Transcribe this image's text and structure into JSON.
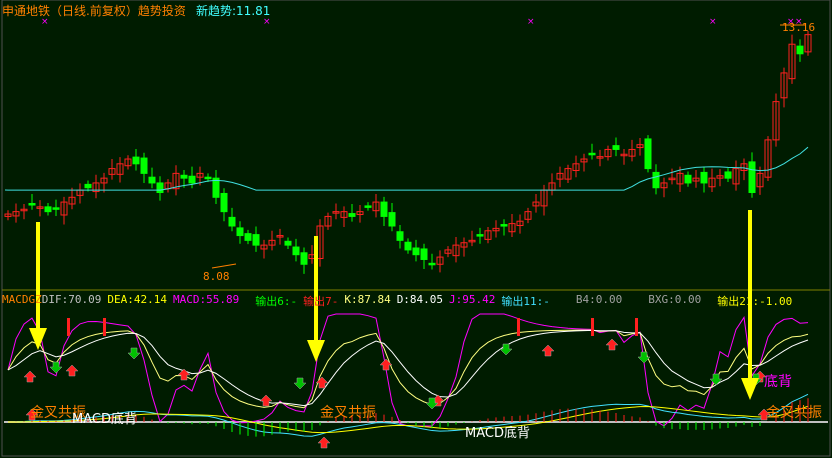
{
  "header": {
    "title": "申通地铁（日线.前复权）趋势投资",
    "trend_label": "新趋势:11.81"
  },
  "price_labels": {
    "high": "13.16",
    "low": "8.08"
  },
  "indicator_bar": [
    {
      "text": "MACDGZ",
      "color": "#ff8000"
    },
    {
      "text": "DIF:70.09",
      "color": "#c0c0c0"
    },
    {
      "text": "DEA:42.14",
      "color": "#ffff00"
    },
    {
      "text": "MACD:55.89",
      "color": "#ff00ff"
    },
    {
      "text": "输出6:-",
      "color": "#00ff00"
    },
    {
      "text": "输出7-",
      "color": "#ff2020"
    },
    {
      "text": "K:87.84",
      "color": "#ffff80"
    },
    {
      "text": "D:84.05",
      "color": "#ffffff"
    },
    {
      "text": "J:95.42",
      "color": "#ff00ff"
    },
    {
      "text": "输出11:-",
      "color": "#40e0ff"
    },
    {
      "text": "B4:0.00",
      "color": "#a0a0a0"
    },
    {
      "text": "BXG:0.00",
      "color": "#a0a0a0"
    },
    {
      "text": "输出21:-1.00",
      "color": "#ffff00"
    }
  ],
  "signals": {
    "golden_cross": "金叉共振",
    "macd_divergence": "MACD底背",
    "divergence": "底背"
  },
  "colors": {
    "bg": "#001c00",
    "up": "#ff2020",
    "down": "#00ff00",
    "ma": "#40e0e0",
    "arrow": "#ffff00"
  },
  "chart_data": {
    "type": "candlestick",
    "title": "申通地铁（日线.前复权）趋势投资",
    "ylim": [
      8.08,
      13.16
    ],
    "closes": [
      9.25,
      9.3,
      9.35,
      9.45,
      9.4,
      9.3,
      9.35,
      9.5,
      9.6,
      9.75,
      9.8,
      9.9,
      10.0,
      10.2,
      10.3,
      10.4,
      10.3,
      10.1,
      9.9,
      9.7,
      9.9,
      10.1,
      10.0,
      9.9,
      10.1,
      10.0,
      9.6,
      9.3,
      9.0,
      8.8,
      8.7,
      8.6,
      8.6,
      8.7,
      8.8,
      8.6,
      8.4,
      8.2,
      8.4,
      9.0,
      9.2,
      9.3,
      9.3,
      9.2,
      9.3,
      9.4,
      9.5,
      9.2,
      9.0,
      8.7,
      8.5,
      8.4,
      8.3,
      8.2,
      8.35,
      8.5,
      8.6,
      8.65,
      8.7,
      8.8,
      8.9,
      8.95,
      9.0,
      9.05,
      9.1,
      9.3,
      9.5,
      9.75,
      9.9,
      10.1,
      10.2,
      10.3,
      10.4,
      10.5,
      10.45,
      10.6,
      10.6,
      10.5,
      10.6,
      10.7,
      10.2,
      9.8,
      9.9,
      10.0,
      10.1,
      9.9,
      10.0,
      9.9,
      10.0,
      10.05,
      10.0,
      10.2,
      10.3,
      9.7,
      10.1,
      10.8,
      11.6,
      12.2,
      12.8,
      12.6,
      13.0
    ]
  }
}
